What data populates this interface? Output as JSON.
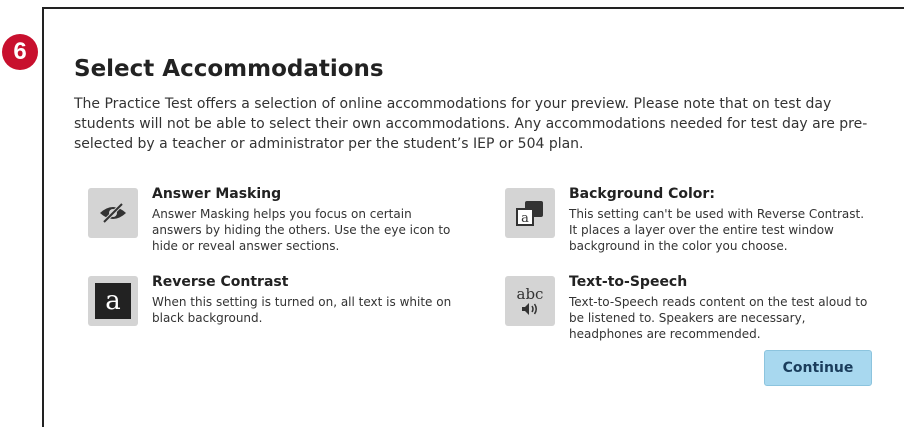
{
  "step_number": "6",
  "title": "Select Accommodations",
  "intro": "The Practice Test offers a selection of online accommodations for your preview. Please note that on test day students will not be able to select their own accommodations. Any accommodations needed for test day are pre-selected by a teacher or administrator per the student’s IEP or 504 plan.",
  "accommodations": [
    {
      "icon": "eye-slash-icon",
      "title": "Answer Masking",
      "description": "Answer Masking helps you focus on certain answers by hiding the others. Use the eye icon to hide or reveal answer sections."
    },
    {
      "icon": "background-color-icon",
      "title": "Background Color:",
      "description": "This setting can't be used with Reverse Contrast. It places a layer over the entire test window background in the color you choose."
    },
    {
      "icon": "reverse-contrast-icon",
      "title": "Reverse Contrast",
      "description": "When this setting is turned on, all text is white on black background.",
      "icon_glyph": "a"
    },
    {
      "icon": "text-to-speech-icon",
      "title": "Text-to-Speech",
      "description": "Text-to-Speech reads content on the test aloud to be listened to. Speakers are necessary, headphones are recommended.",
      "icon_glyph": "abc"
    }
  ],
  "continue_label": "Continue",
  "colors": {
    "badge": "#c8102e",
    "button": "#a8d8ef",
    "icon_bg": "#d4d4d4"
  }
}
